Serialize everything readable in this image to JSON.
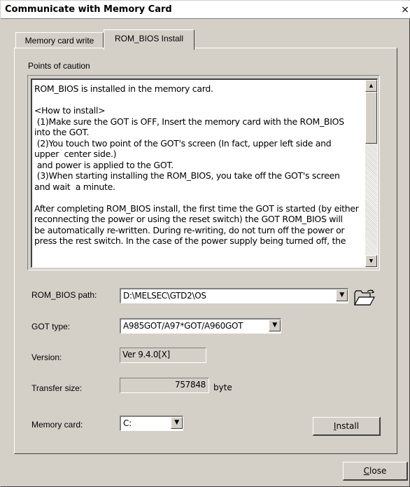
{
  "window": {
    "title": "Communicate with Memory Card",
    "close_glyph": "×"
  },
  "tabs": [
    {
      "label": "Memory card write",
      "active": false
    },
    {
      "label": "ROM_BIOS Install",
      "active": true
    }
  ],
  "caution": {
    "heading": "Points of caution",
    "text": "ROM_BIOS is installed in the memory card.\n\n<How to install>\n (1)Make sure the GOT is OFF, Insert the memory card with the ROM_BIOS\ninto the GOT.\n (2)You touch two point of the GOT's screen (In fact, upper left side and\nupper  center side.)\n and power is applied to the GOT.\n (3)When starting installing the ROM_BIOS, you take off the GOT's screen\nand wait  a minute.\n\nAfter completing ROM_BIOS install, the first time the GOT is started (by either\nreconnecting the power or using the reset switch) the GOT ROM_BIOS will\nbe automatically re-written. During re-writing, do not turn off the power or\npress the rest switch. In the case of the power supply being turned off, the"
  },
  "form": {
    "rom_bios_path": {
      "label": "ROM_BIOS path:",
      "value": "D:\\MELSEC\\GTD2\\OS"
    },
    "got_type": {
      "label": "GOT type:",
      "value": "A985GOT/A97*GOT/A960GOT"
    },
    "version": {
      "label": "Version:",
      "value": "Ver 9.4.0[X]"
    },
    "transfer_size": {
      "label": "Transfer size:",
      "value": "757848",
      "unit": "byte"
    },
    "memory_card": {
      "label": "Memory card:",
      "value": "C:"
    }
  },
  "buttons": {
    "install": {
      "accel": "I",
      "rest": "nstall"
    },
    "close": {
      "accel": "C",
      "rest": "lose"
    }
  },
  "icons": {
    "scroll_up": "▲",
    "scroll_down": "▼",
    "dropdown": "▼",
    "browse": "folder-open-icon"
  }
}
